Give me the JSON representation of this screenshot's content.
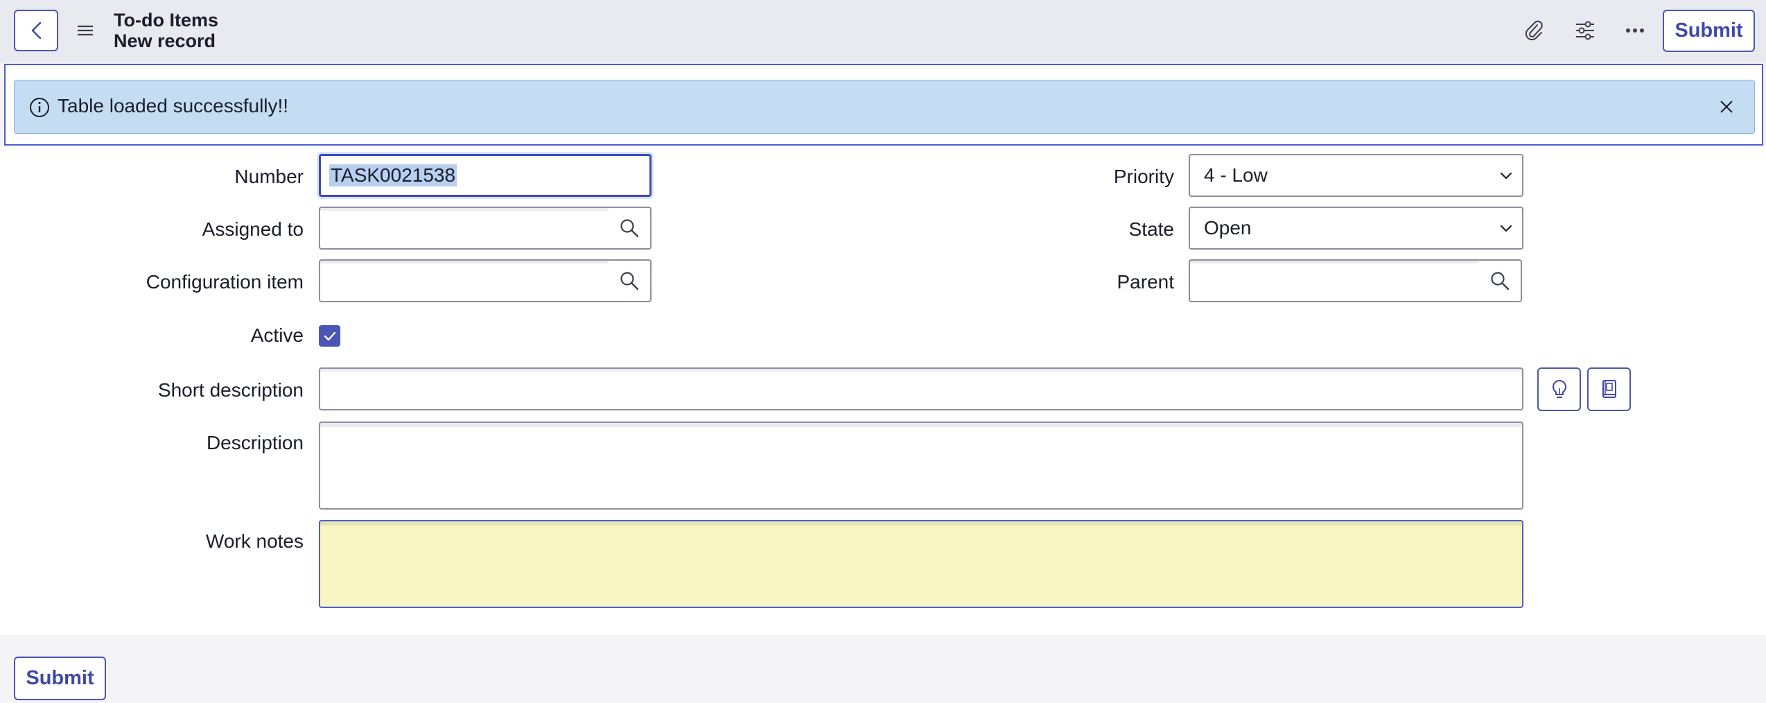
{
  "header": {
    "title": "To-do Items",
    "subtitle": "New record",
    "submit_label": "Submit",
    "icons": [
      "back-icon",
      "menu-icon",
      "paperclip-icon",
      "sliders-icon",
      "more-icon"
    ]
  },
  "alert": {
    "message": "Table loaded successfully!!",
    "icon": "info-icon"
  },
  "form": {
    "number": {
      "label": "Number",
      "value": "TASK0021538"
    },
    "assigned_to": {
      "label": "Assigned to",
      "value": ""
    },
    "configuration_item": {
      "label": "Configuration item",
      "value": ""
    },
    "active": {
      "label": "Active",
      "checked": true
    },
    "priority": {
      "label": "Priority",
      "value": "4 - Low"
    },
    "state": {
      "label": "State",
      "value": "Open"
    },
    "parent": {
      "label": "Parent",
      "value": ""
    },
    "short_description": {
      "label": "Short description",
      "value": ""
    },
    "description": {
      "label": "Description",
      "value": ""
    },
    "work_notes": {
      "label": "Work notes",
      "value": ""
    }
  },
  "footer": {
    "submit_label": "Submit"
  },
  "colors": {
    "accent": "#4b55b5",
    "alert_bg": "#c5ddf2",
    "work_notes_bg": "#faf6c4",
    "header_bg": "#e9eaef"
  }
}
